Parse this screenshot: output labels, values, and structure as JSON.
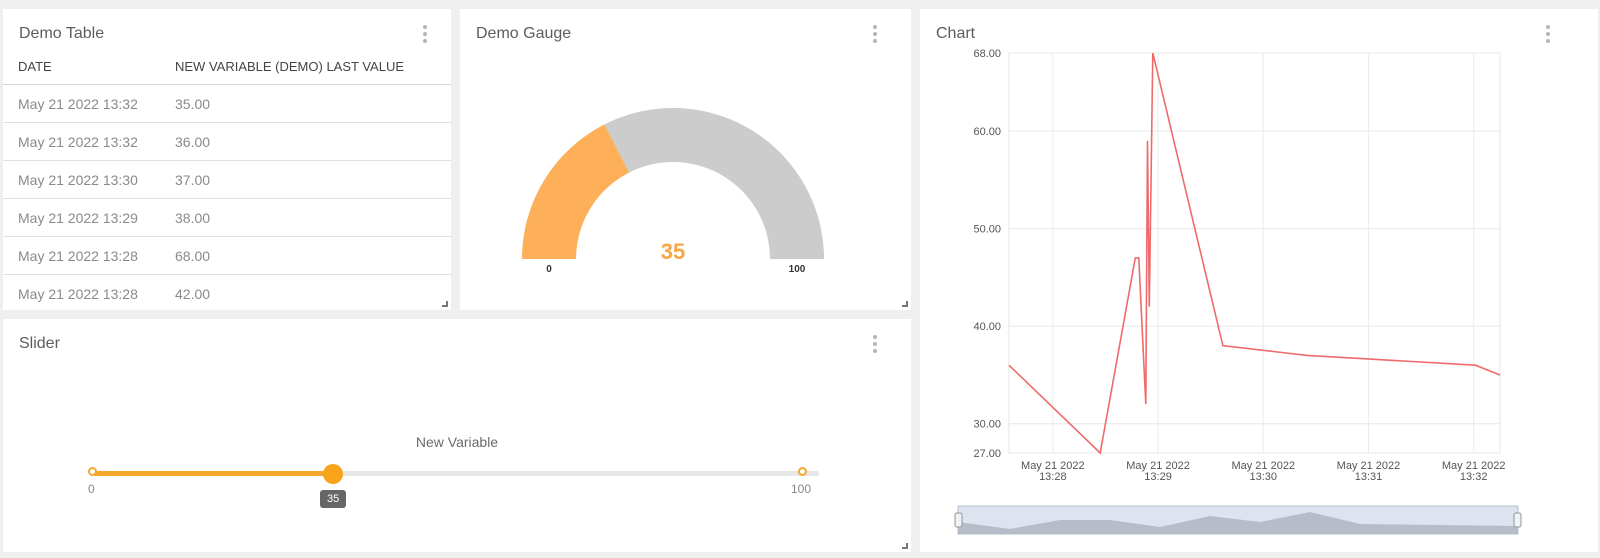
{
  "table": {
    "title": "Demo Table",
    "columns": [
      "DATE",
      "NEW VARIABLE (DEMO) LAST VALUE"
    ],
    "rows": [
      {
        "date": "May 21 2022 13:32",
        "value": "35.00"
      },
      {
        "date": "May 21 2022 13:32",
        "value": "36.00"
      },
      {
        "date": "May 21 2022 13:30",
        "value": "37.00"
      },
      {
        "date": "May 21 2022 13:29",
        "value": "38.00"
      },
      {
        "date": "May 21 2022 13:28",
        "value": "68.00"
      },
      {
        "date": "May 21 2022 13:28",
        "value": "42.00"
      }
    ]
  },
  "gauge": {
    "title": "Demo Gauge",
    "value": 35,
    "min": 0,
    "max": 100,
    "value_label": "35",
    "min_label": "0",
    "max_label": "100",
    "fill_color": "#feb058",
    "track_color": "#cccccc"
  },
  "slider": {
    "title": "Slider",
    "label": "New Variable",
    "value": 35,
    "value_label": "35",
    "min": 0,
    "max": 100,
    "min_label": "0",
    "max_label": "100",
    "accent_color": "#f3a629"
  },
  "chart": {
    "title": "Chart",
    "line_color": "#ef6a6a"
  },
  "chart_data": {
    "type": "line",
    "ylim": [
      27,
      68
    ],
    "y_ticks": [
      "68.00",
      "60.00",
      "50.00",
      "40.00",
      "30.00",
      "27.00"
    ],
    "y_tick_values": [
      68,
      60,
      50,
      40,
      30,
      27
    ],
    "x_ticks": [
      {
        "t": "13:28:00",
        "date": "May 21 2022",
        "time": "13:28"
      },
      {
        "t": "13:29:00",
        "date": "May 21 2022",
        "time": "13:29"
      },
      {
        "t": "13:30:00",
        "date": "May 21 2022",
        "time": "13:30"
      },
      {
        "t": "13:31:00",
        "date": "May 21 2022",
        "time": "13:31"
      },
      {
        "t": "13:32:00",
        "date": "May 21 2022",
        "time": "13:32"
      }
    ],
    "xlim": [
      "13:27:35",
      "13:32:15"
    ],
    "series": [
      {
        "points": [
          {
            "t": "13:27:35",
            "v": 36
          },
          {
            "t": "13:28:27",
            "v": 27
          },
          {
            "t": "13:28:47",
            "v": 47
          },
          {
            "t": "13:28:49",
            "v": 47
          },
          {
            "t": "13:28:53",
            "v": 32
          },
          {
            "t": "13:28:54",
            "v": 59
          },
          {
            "t": "13:28:55",
            "v": 42
          },
          {
            "t": "13:28:57",
            "v": 68
          },
          {
            "t": "13:29:37",
            "v": 38
          },
          {
            "t": "13:30:25",
            "v": 37
          },
          {
            "t": "13:32:01",
            "v": 36
          },
          {
            "t": "13:32:15",
            "v": 35
          }
        ]
      }
    ],
    "grid": true
  }
}
